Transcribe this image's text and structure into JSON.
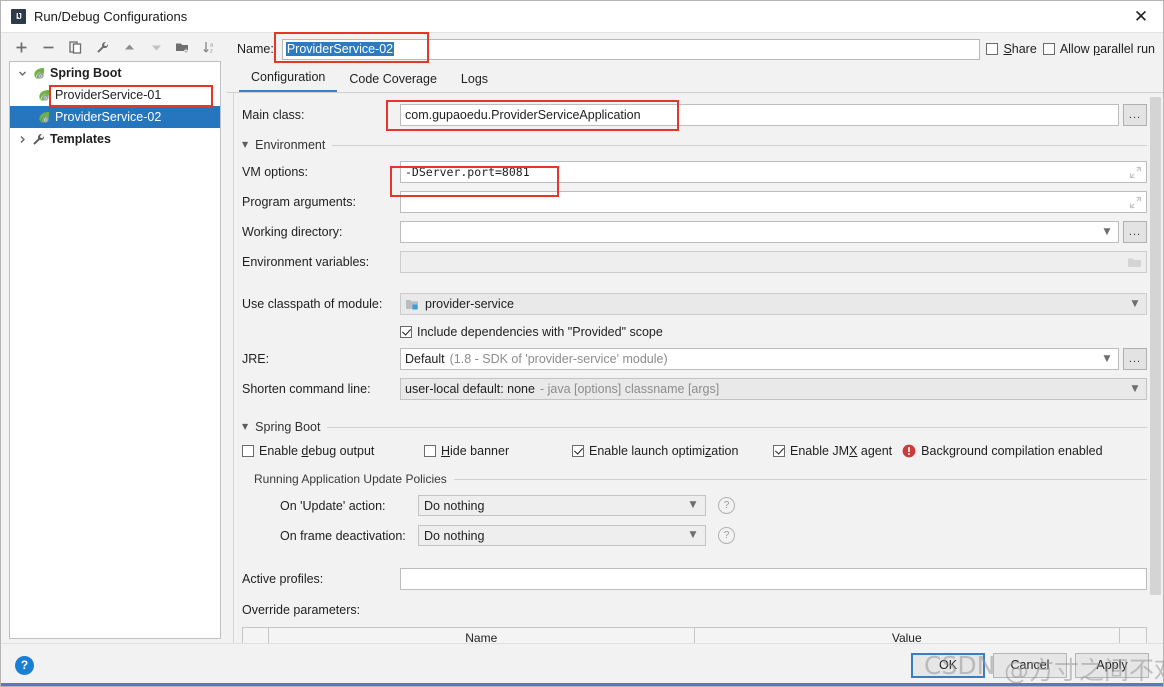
{
  "window": {
    "title": "Run/Debug Configurations",
    "app_icon": "intellij-idea-logo",
    "close_icon": "close-icon"
  },
  "toolbar": {
    "icons": [
      {
        "name": "add-icon",
        "glyph": "+"
      },
      {
        "name": "remove-icon",
        "glyph": "−"
      },
      {
        "name": "copy-icon",
        "glyph": "copy"
      },
      {
        "name": "edit-templates-icon",
        "glyph": "wrench"
      },
      {
        "name": "move-up-icon",
        "glyph": "▲"
      },
      {
        "name": "move-down-icon",
        "glyph": "▼"
      },
      {
        "name": "new-folder-icon",
        "glyph": "folder-plus"
      },
      {
        "name": "sort-alphabetically-icon",
        "glyph": "sort-az"
      }
    ]
  },
  "tree": {
    "nodes": [
      {
        "label": "Spring Boot",
        "level": 1,
        "bold": true,
        "expanded": true,
        "icon": "spring-boot-leaf-icon",
        "selected": false
      },
      {
        "label": "ProviderService-01",
        "level": 2,
        "bold": false,
        "icon": "spring-boot-leaf-icon",
        "selected": false
      },
      {
        "label": "ProviderService-02",
        "level": 2,
        "bold": false,
        "icon": "spring-boot-leaf-icon",
        "selected": true
      },
      {
        "label": "Templates",
        "level": 1,
        "bold": true,
        "expanded": false,
        "icon": "wrench-icon",
        "selected": false
      }
    ]
  },
  "name_row": {
    "label": "Name:",
    "value": "ProviderService-02",
    "share_label": "Share",
    "share_mnemonic": "S",
    "share_checked": false,
    "parallel_label": "Allow parallel run",
    "parallel_mnemonic": "p",
    "parallel_checked": false
  },
  "tabs": [
    {
      "label": "Configuration",
      "active": true
    },
    {
      "label": "Code Coverage",
      "active": false
    },
    {
      "label": "Logs",
      "active": false
    }
  ],
  "form": {
    "main_class": {
      "label": "Main class:",
      "value": "com.gupaoedu.ProviderServiceApplication",
      "browse": "..."
    },
    "environment_group": "Environment",
    "vm_options": {
      "label": "VM options:",
      "value": "-DServer.port=8081"
    },
    "program_arguments": {
      "label": "Program arguments:",
      "value": ""
    },
    "working_directory": {
      "label": "Working directory:",
      "value": "",
      "browse": "..."
    },
    "environment_variables": {
      "label": "Environment variables:",
      "value": ""
    },
    "classpath_module": {
      "label": "Use classpath of module:",
      "value": "provider-service"
    },
    "include_provided": {
      "label": "Include dependencies with \"Provided\" scope",
      "checked": true
    },
    "jre": {
      "label": "JRE:",
      "value": "Default",
      "hint": "(1.8 - SDK of 'provider-service' module)",
      "browse": "..."
    },
    "shorten_command_line": {
      "label": "Shorten command line:",
      "value": "user-local default: none",
      "hint": "- java [options] classname [args]"
    },
    "spring_boot_group": "Spring Boot",
    "spring_checkboxes": [
      {
        "label": "Enable debug output",
        "mnemonic": "d",
        "checked": false
      },
      {
        "label": "Hide banner",
        "mnemonic": "H",
        "checked": false
      },
      {
        "label": "Enable launch optimization",
        "mnemonic": "z",
        "checked": true
      },
      {
        "label": "Enable JMX agent",
        "mnemonic": "X",
        "checked": true
      }
    ],
    "background_warning": {
      "text": "Background compilation enabled",
      "icon": "error-icon"
    },
    "policies_group": "Running Application Update Policies",
    "policies": [
      {
        "label": "On 'Update' action:",
        "value": "Do nothing",
        "help": "?"
      },
      {
        "label": "On frame deactivation:",
        "value": "Do nothing",
        "help": "?"
      }
    ],
    "active_profiles": {
      "label": "Active profiles:",
      "value": ""
    },
    "override_parameters": {
      "label": "Override parameters:",
      "columns": [
        "",
        "Name",
        "Value",
        ""
      ]
    }
  },
  "footer": {
    "help_icon": "help-icon",
    "buttons": [
      {
        "label": "OK",
        "default": true
      },
      {
        "label": "Cancel",
        "default": false
      },
      {
        "label": "Apply",
        "default": false
      }
    ]
  },
  "watermark": {
    "site": "CSDN",
    "user": "@方寸之间不欢闲"
  },
  "colors": {
    "accent": "#2675bf",
    "annotation": "#e8352a",
    "tab_underline": "#3f7fbf",
    "error": "#cc3b3b",
    "help_blue": "#1a7fd4"
  }
}
